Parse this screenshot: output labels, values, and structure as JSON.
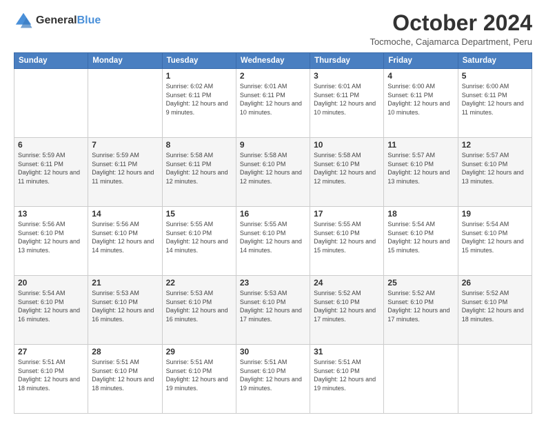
{
  "logo": {
    "general": "General",
    "blue": "Blue"
  },
  "title": "October 2024",
  "subtitle": "Tocmoche, Cajamarca Department, Peru",
  "days_of_week": [
    "Sunday",
    "Monday",
    "Tuesday",
    "Wednesday",
    "Thursday",
    "Friday",
    "Saturday"
  ],
  "weeks": [
    [
      {
        "day": "",
        "info": ""
      },
      {
        "day": "",
        "info": ""
      },
      {
        "day": "1",
        "info": "Sunrise: 6:02 AM\nSunset: 6:11 PM\nDaylight: 12 hours and 9 minutes."
      },
      {
        "day": "2",
        "info": "Sunrise: 6:01 AM\nSunset: 6:11 PM\nDaylight: 12 hours and 10 minutes."
      },
      {
        "day": "3",
        "info": "Sunrise: 6:01 AM\nSunset: 6:11 PM\nDaylight: 12 hours and 10 minutes."
      },
      {
        "day": "4",
        "info": "Sunrise: 6:00 AM\nSunset: 6:11 PM\nDaylight: 12 hours and 10 minutes."
      },
      {
        "day": "5",
        "info": "Sunrise: 6:00 AM\nSunset: 6:11 PM\nDaylight: 12 hours and 11 minutes."
      }
    ],
    [
      {
        "day": "6",
        "info": "Sunrise: 5:59 AM\nSunset: 6:11 PM\nDaylight: 12 hours and 11 minutes."
      },
      {
        "day": "7",
        "info": "Sunrise: 5:59 AM\nSunset: 6:11 PM\nDaylight: 12 hours and 11 minutes."
      },
      {
        "day": "8",
        "info": "Sunrise: 5:58 AM\nSunset: 6:11 PM\nDaylight: 12 hours and 12 minutes."
      },
      {
        "day": "9",
        "info": "Sunrise: 5:58 AM\nSunset: 6:10 PM\nDaylight: 12 hours and 12 minutes."
      },
      {
        "day": "10",
        "info": "Sunrise: 5:58 AM\nSunset: 6:10 PM\nDaylight: 12 hours and 12 minutes."
      },
      {
        "day": "11",
        "info": "Sunrise: 5:57 AM\nSunset: 6:10 PM\nDaylight: 12 hours and 13 minutes."
      },
      {
        "day": "12",
        "info": "Sunrise: 5:57 AM\nSunset: 6:10 PM\nDaylight: 12 hours and 13 minutes."
      }
    ],
    [
      {
        "day": "13",
        "info": "Sunrise: 5:56 AM\nSunset: 6:10 PM\nDaylight: 12 hours and 13 minutes."
      },
      {
        "day": "14",
        "info": "Sunrise: 5:56 AM\nSunset: 6:10 PM\nDaylight: 12 hours and 14 minutes."
      },
      {
        "day": "15",
        "info": "Sunrise: 5:55 AM\nSunset: 6:10 PM\nDaylight: 12 hours and 14 minutes."
      },
      {
        "day": "16",
        "info": "Sunrise: 5:55 AM\nSunset: 6:10 PM\nDaylight: 12 hours and 14 minutes."
      },
      {
        "day": "17",
        "info": "Sunrise: 5:55 AM\nSunset: 6:10 PM\nDaylight: 12 hours and 15 minutes."
      },
      {
        "day": "18",
        "info": "Sunrise: 5:54 AM\nSunset: 6:10 PM\nDaylight: 12 hours and 15 minutes."
      },
      {
        "day": "19",
        "info": "Sunrise: 5:54 AM\nSunset: 6:10 PM\nDaylight: 12 hours and 15 minutes."
      }
    ],
    [
      {
        "day": "20",
        "info": "Sunrise: 5:54 AM\nSunset: 6:10 PM\nDaylight: 12 hours and 16 minutes."
      },
      {
        "day": "21",
        "info": "Sunrise: 5:53 AM\nSunset: 6:10 PM\nDaylight: 12 hours and 16 minutes."
      },
      {
        "day": "22",
        "info": "Sunrise: 5:53 AM\nSunset: 6:10 PM\nDaylight: 12 hours and 16 minutes."
      },
      {
        "day": "23",
        "info": "Sunrise: 5:53 AM\nSunset: 6:10 PM\nDaylight: 12 hours and 17 minutes."
      },
      {
        "day": "24",
        "info": "Sunrise: 5:52 AM\nSunset: 6:10 PM\nDaylight: 12 hours and 17 minutes."
      },
      {
        "day": "25",
        "info": "Sunrise: 5:52 AM\nSunset: 6:10 PM\nDaylight: 12 hours and 17 minutes."
      },
      {
        "day": "26",
        "info": "Sunrise: 5:52 AM\nSunset: 6:10 PM\nDaylight: 12 hours and 18 minutes."
      }
    ],
    [
      {
        "day": "27",
        "info": "Sunrise: 5:51 AM\nSunset: 6:10 PM\nDaylight: 12 hours and 18 minutes."
      },
      {
        "day": "28",
        "info": "Sunrise: 5:51 AM\nSunset: 6:10 PM\nDaylight: 12 hours and 18 minutes."
      },
      {
        "day": "29",
        "info": "Sunrise: 5:51 AM\nSunset: 6:10 PM\nDaylight: 12 hours and 19 minutes."
      },
      {
        "day": "30",
        "info": "Sunrise: 5:51 AM\nSunset: 6:10 PM\nDaylight: 12 hours and 19 minutes."
      },
      {
        "day": "31",
        "info": "Sunrise: 5:51 AM\nSunset: 6:10 PM\nDaylight: 12 hours and 19 minutes."
      },
      {
        "day": "",
        "info": ""
      },
      {
        "day": "",
        "info": ""
      }
    ]
  ]
}
